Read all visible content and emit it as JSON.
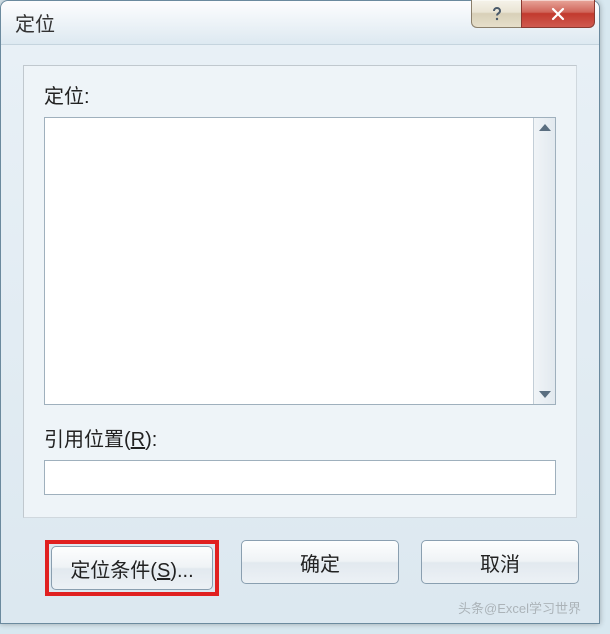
{
  "title": "定位",
  "labels": {
    "goto": "定位:",
    "reference_prefix": "引用位置(",
    "reference_key": "R",
    "reference_suffix": "):"
  },
  "buttons": {
    "special_prefix": "定位条件(",
    "special_key": "S",
    "special_suffix": ")...",
    "ok": "确定",
    "cancel": "取消"
  },
  "watermark": "头条@Excel学习世界"
}
